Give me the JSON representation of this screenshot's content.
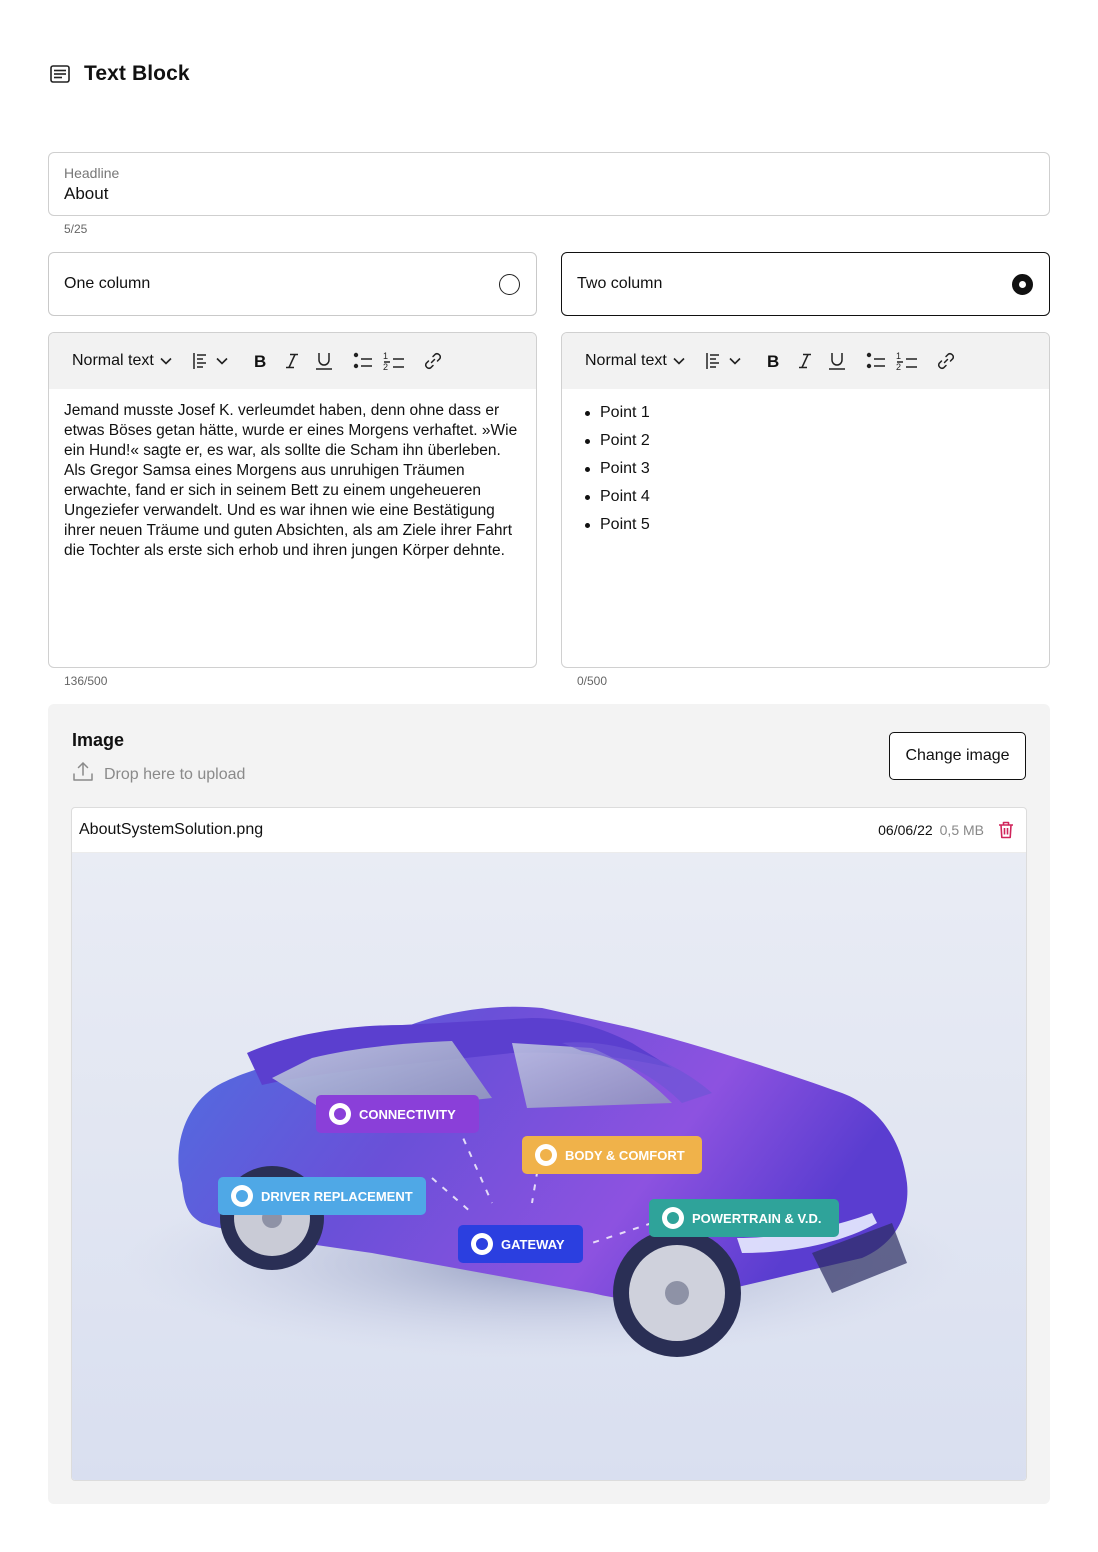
{
  "page": {
    "title": "Text Block",
    "title_icon": "text-block-icon"
  },
  "headline": {
    "label": "Headline",
    "value": "About",
    "counter": "5/25"
  },
  "layout_options": [
    {
      "label": "One column",
      "selected": false
    },
    {
      "label": "Two column",
      "selected": true
    }
  ],
  "editors": [
    {
      "format_label": "Normal text",
      "toolbar_icons": [
        "align-icon",
        "chevron-down-icon",
        "bold-icon",
        "italic-icon",
        "underline-icon",
        "bullet-list-icon",
        "numbered-list-icon",
        "link-icon"
      ],
      "text": "Jemand musste Josef K. verleumdet haben, denn ohne dass er etwas Böses getan hätte, wurde er eines Morgens verhaftet. »Wie ein Hund!« sagte er, es war, als sollte die Scham ihn überleben. Als Gregor Samsa eines Morgens aus unruhigen Träumen erwachte, fand er sich in seinem Bett zu einem ungeheueren Ungeziefer verwandelt. Und es war ihnen wie eine Bestätigung ihrer neuen Träume und guten Absichten, als am Ziele ihrer Fahrt die Tochter als erste sich erhob und ihren jungen Körper dehnte.",
      "counter": "136/500"
    },
    {
      "format_label": "Normal text",
      "toolbar_icons": [
        "align-icon",
        "chevron-down-icon",
        "bold-icon",
        "italic-icon",
        "underline-icon",
        "bullet-list-icon",
        "numbered-list-icon",
        "link-icon"
      ],
      "list": [
        "Point 1",
        "Point 2",
        "Point 3",
        "Point 4",
        "Point 5"
      ],
      "counter": "0/500"
    }
  ],
  "image": {
    "heading": "Image",
    "drop_label": "Drop here to upload",
    "change_button": "Change image",
    "file": {
      "name": "AboutSystemSolution.png",
      "date": "06/06/22",
      "size": "0,5 MB"
    },
    "preview_labels": [
      "CONNECTIVITY",
      "BODY & COMFORT",
      "DRIVER REPLACEMENT",
      "POWERTRAIN & V.D.",
      "GATEWAY"
    ]
  },
  "colors": {
    "connectivity": "#8a3fd9",
    "body_comfort": "#f0b24a",
    "driver_replacement": "#4fa8e6",
    "powertrain": "#2fa39a",
    "gateway": "#2b3fe0",
    "trash": "#d0245a"
  }
}
